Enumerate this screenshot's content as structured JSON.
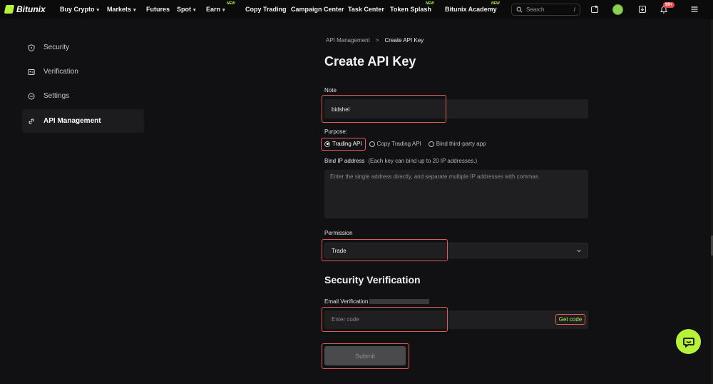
{
  "brand": {
    "name": "Bitunix"
  },
  "nav": {
    "items": [
      {
        "label": "Buy Crypto",
        "caret": true
      },
      {
        "label": "Markets",
        "caret": true
      },
      {
        "label": "Futures"
      },
      {
        "label": "Spot",
        "caret": true
      },
      {
        "label": "Earn",
        "caret": true,
        "new": "NEW"
      },
      {
        "label": "Copy Trading"
      },
      {
        "label": "Campaign Center"
      },
      {
        "label": "Task Center"
      },
      {
        "label": "Token Splash",
        "new": "NEW"
      },
      {
        "label": "Bitunix Academy",
        "new": "NEW"
      }
    ],
    "search_placeholder": "Search",
    "search_shortcut": "/",
    "notifications_badge": "99+"
  },
  "sidebar": {
    "items": [
      {
        "label": "Security",
        "icon": "shield-icon"
      },
      {
        "label": "Verification",
        "icon": "id-card-icon"
      },
      {
        "label": "Settings",
        "icon": "settings-icon"
      },
      {
        "label": "API Management",
        "icon": "link-icon",
        "active": true
      }
    ]
  },
  "breadcrumb": {
    "parent": "API Management",
    "separator": ">",
    "current": "Create API Key"
  },
  "page": {
    "title": "Create API Key"
  },
  "form": {
    "note_label": "Note",
    "note_value": "bidshel",
    "purpose_label": "Purpose:",
    "purpose_options": [
      {
        "label": "Trading API",
        "selected": true
      },
      {
        "label": "Copy Trading API",
        "selected": false
      },
      {
        "label": "Bind third-party app",
        "selected": false
      }
    ],
    "ip_label": "Bind IP address",
    "ip_hint": "(Each key can bind up to 20 IP addresses.)",
    "ip_placeholder": "Enter the single address directly, and separate multiple IP addresses with commas.",
    "permission_label": "Permission",
    "permission_value": "Trade"
  },
  "security": {
    "title": "Security Verification",
    "email_label": "Email Verification",
    "code_placeholder": "Enter code",
    "get_code_label": "Get code",
    "submit_label": "Submit"
  },
  "colors": {
    "accent": "#b7f23b",
    "highlight": "#e25b5b",
    "background": "#111113"
  }
}
